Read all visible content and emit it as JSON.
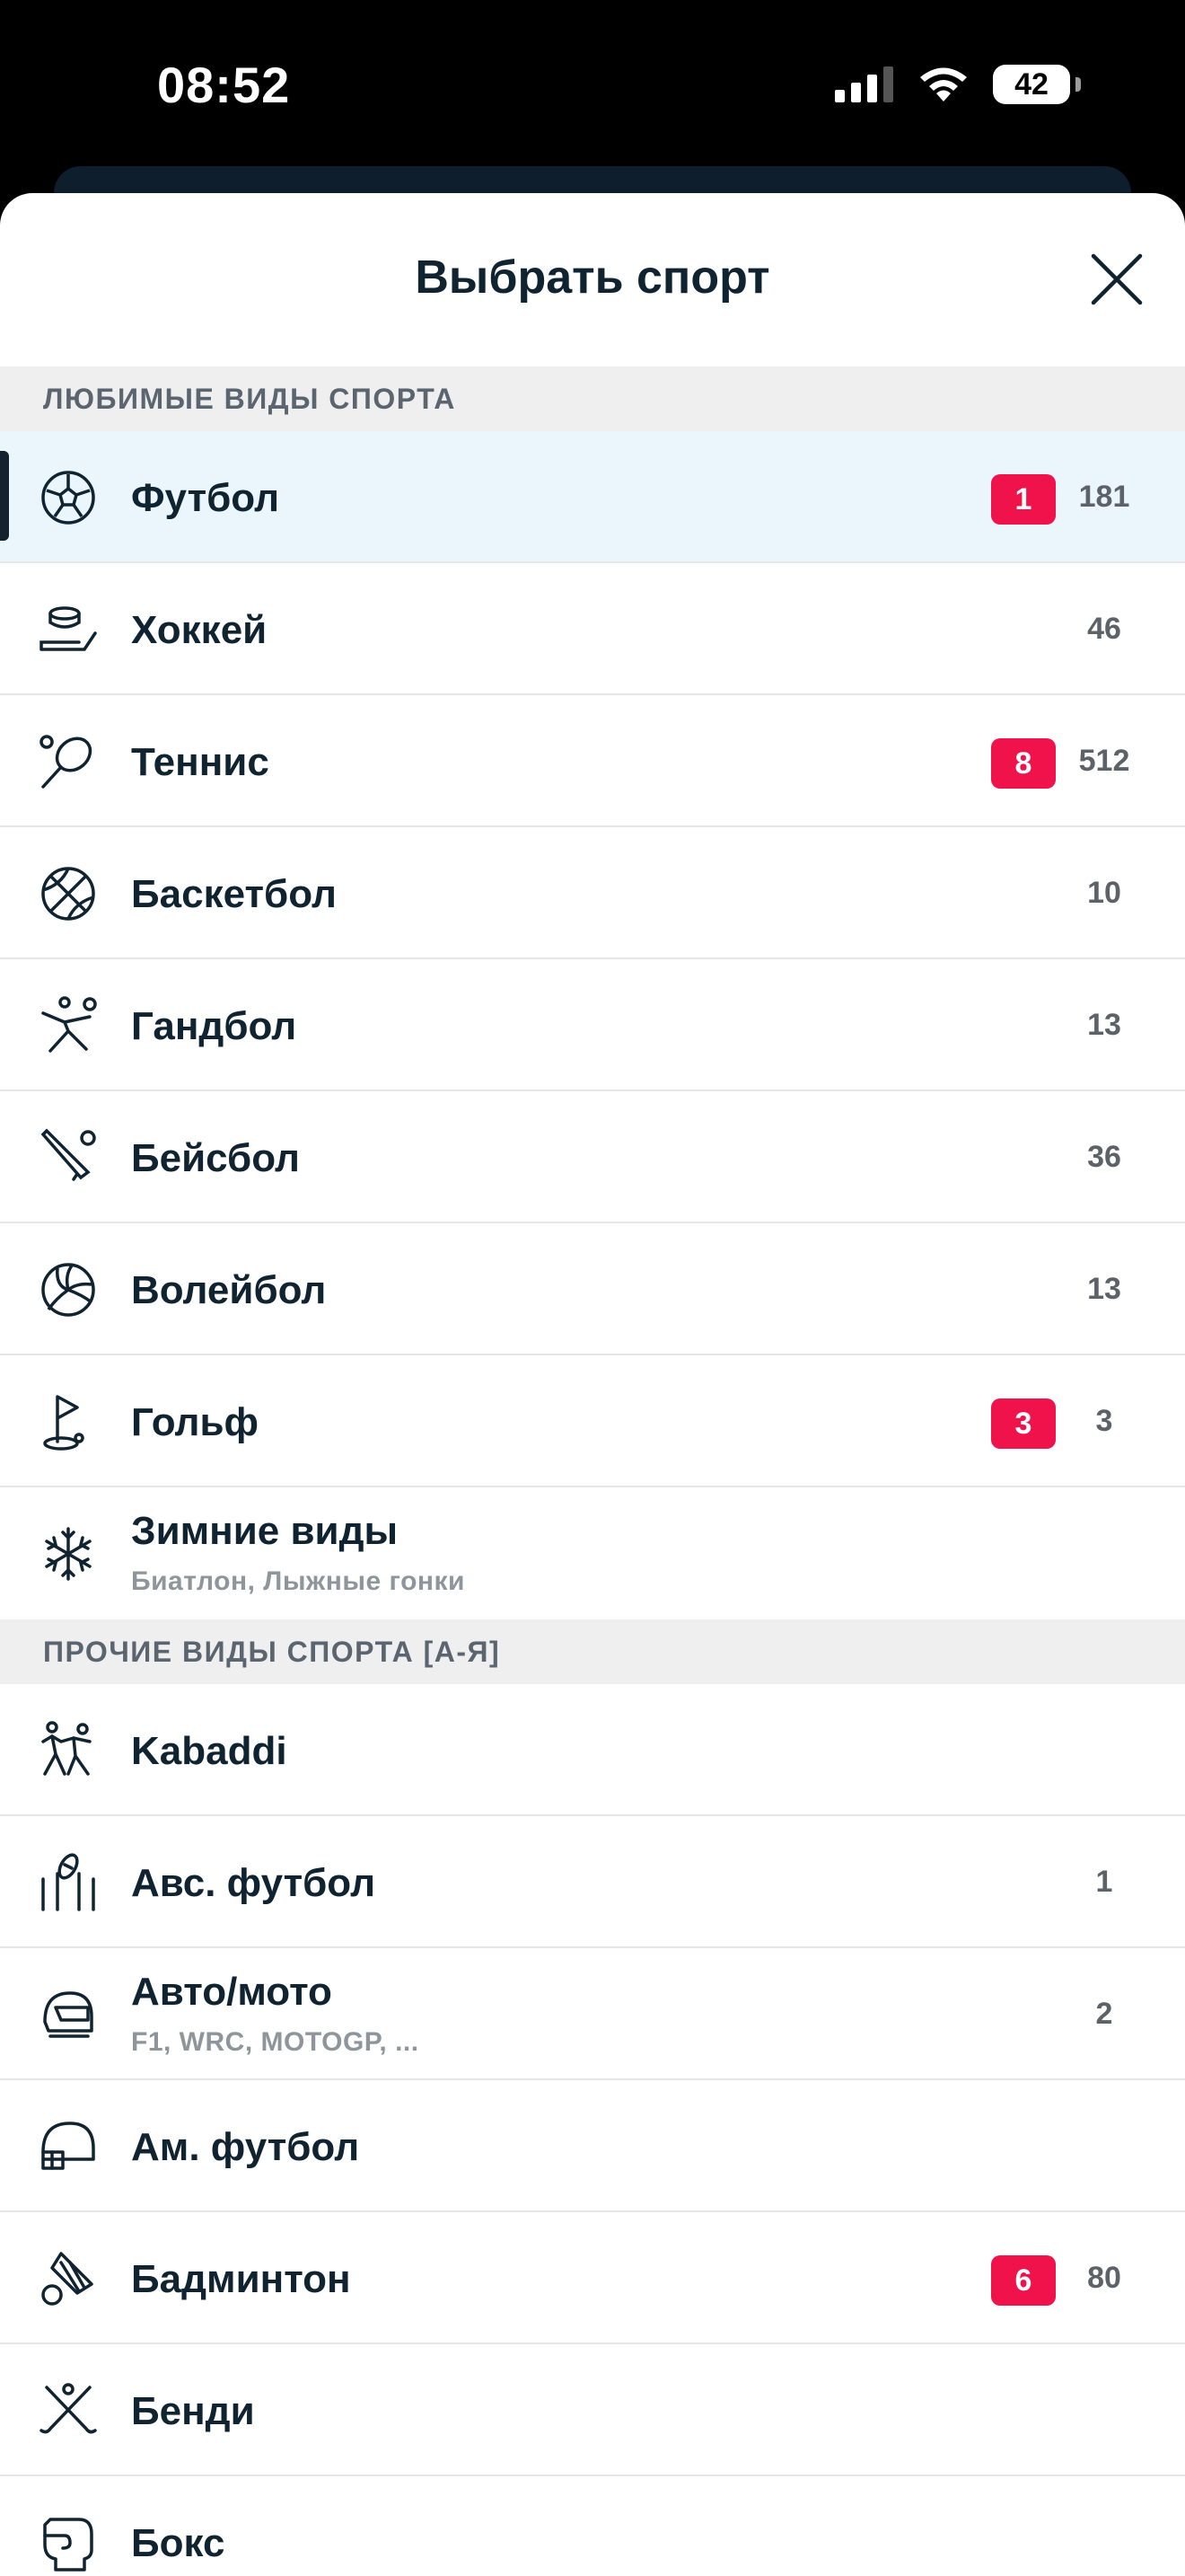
{
  "status_bar": {
    "time": "08:52",
    "battery": "42"
  },
  "sheet": {
    "title": "Выбрать спорт"
  },
  "colors": {
    "badge": "#f0124b",
    "text": "#102331",
    "active_row": "#eaf5fc"
  },
  "favorites": {
    "header": "ЛЮБИМЫЕ ВИДЫ СПОРТА",
    "items": [
      {
        "label": "Футбол",
        "badge": "1",
        "count": "181",
        "icon": "soccer-ball-icon"
      },
      {
        "label": "Хоккей",
        "count": "46",
        "icon": "hockey-icon"
      },
      {
        "label": "Теннис",
        "badge": "8",
        "count": "512",
        "icon": "tennis-icon"
      },
      {
        "label": "Баскетбол",
        "count": "10",
        "icon": "basketball-icon"
      },
      {
        "label": "Гандбол",
        "count": "13",
        "icon": "handball-icon"
      },
      {
        "label": "Бейсбол",
        "count": "36",
        "icon": "baseball-icon"
      },
      {
        "label": "Волейбол",
        "count": "13",
        "icon": "volleyball-icon"
      },
      {
        "label": "Гольф",
        "badge": "3",
        "count": "3",
        "icon": "golf-icon"
      },
      {
        "label": "Зимние виды",
        "sub": "Биатлон, Лыжные гонки",
        "icon": "snowflake-icon"
      }
    ]
  },
  "others": {
    "header": "ПРОЧИЕ ВИДЫ СПОРТА [А-Я]",
    "items": [
      {
        "label": "Kabaddi",
        "icon": "kabaddi-icon"
      },
      {
        "label": "Авс. футбол",
        "count": "1",
        "icon": "aussie-football-icon"
      },
      {
        "label": "Авто/мото",
        "sub": "F1, WRC, MOTOGP, ...",
        "count": "2",
        "icon": "helmet-icon"
      },
      {
        "label": "Ам. футбол",
        "icon": "football-helmet-icon"
      },
      {
        "label": "Бадминтон",
        "badge": "6",
        "count": "80",
        "icon": "shuttlecock-icon"
      },
      {
        "label": "Бенди",
        "icon": "bandy-icon"
      },
      {
        "label": "Бокс",
        "icon": "boxing-glove-icon"
      }
    ]
  }
}
